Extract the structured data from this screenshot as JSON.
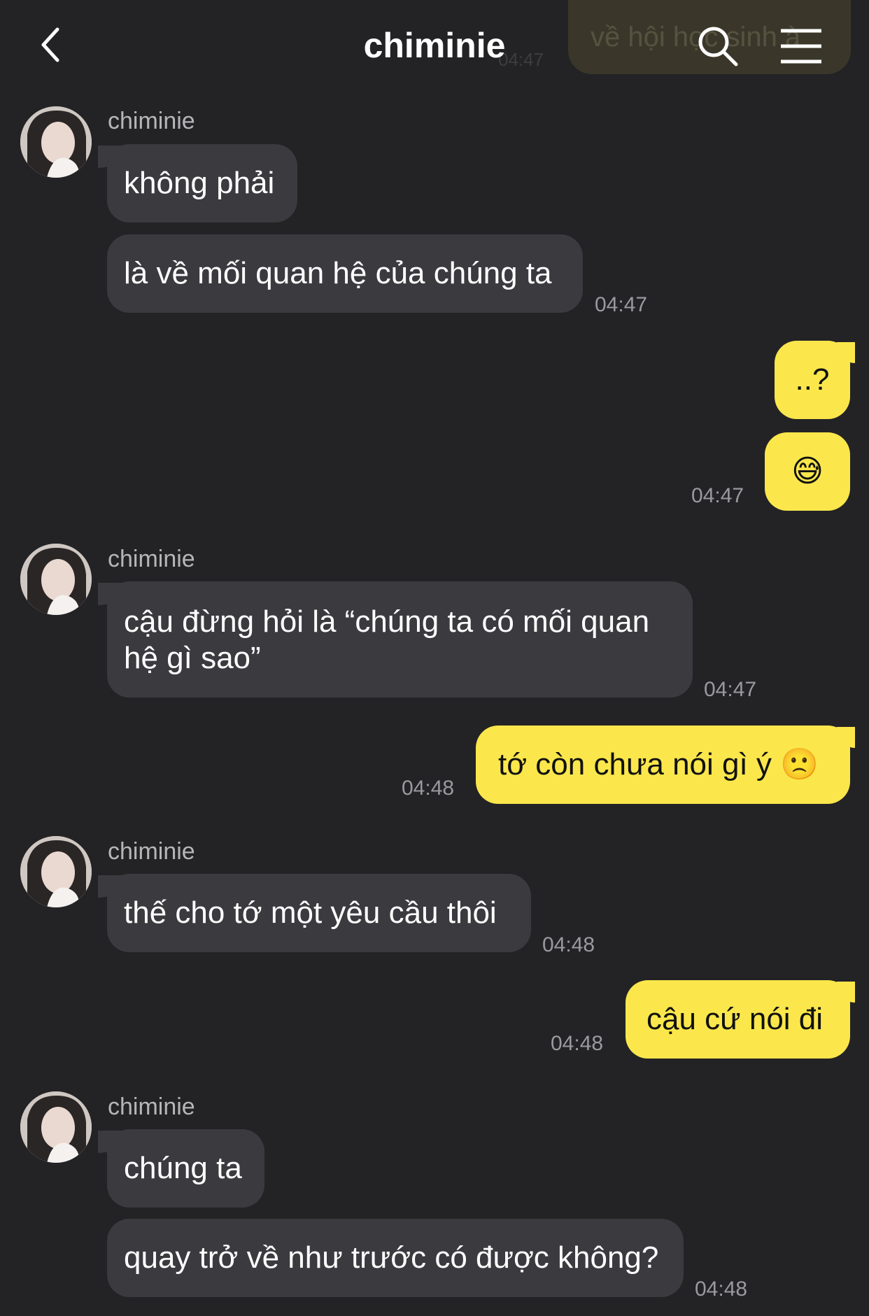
{
  "header": {
    "title": "chiminie",
    "ghost_preview": "về hội học sinh à",
    "ghost_time": "04:47"
  },
  "icons": {
    "back": "chevron-left-icon",
    "search": "search-icon",
    "menu": "hamburger-menu-icon"
  },
  "colors": {
    "background": "#232326",
    "incoming_bubble": "#3b3b3f",
    "outgoing_bubble": "#fbe74b",
    "time_text": "#9a9a9e"
  },
  "messages": {
    "g1": {
      "sender": "chiminie",
      "m1": "không phải",
      "m2": "là về mối quan hệ của chúng ta",
      "time": "04:47"
    },
    "g2": {
      "m1": "..?",
      "m2": "😅",
      "time": "04:47"
    },
    "g3": {
      "sender": "chiminie",
      "m1_line1": "cậu đừng hỏi là “chúng ta có mối quan",
      "m1_line2": "hệ gì sao”",
      "time": "04:47"
    },
    "g4": {
      "m1": "tớ còn chưa nói gì ý 🙁",
      "time": "04:48"
    },
    "g5": {
      "sender": "chiminie",
      "m1": "thế cho tớ một yêu cầu thôi",
      "time": "04:48"
    },
    "g6": {
      "m1": "cậu cứ nói đi",
      "time": "04:48"
    },
    "g7": {
      "sender": "chiminie",
      "m1": "chúng ta",
      "m2": "quay trở về như trước có được không?",
      "time": "04:48"
    }
  }
}
